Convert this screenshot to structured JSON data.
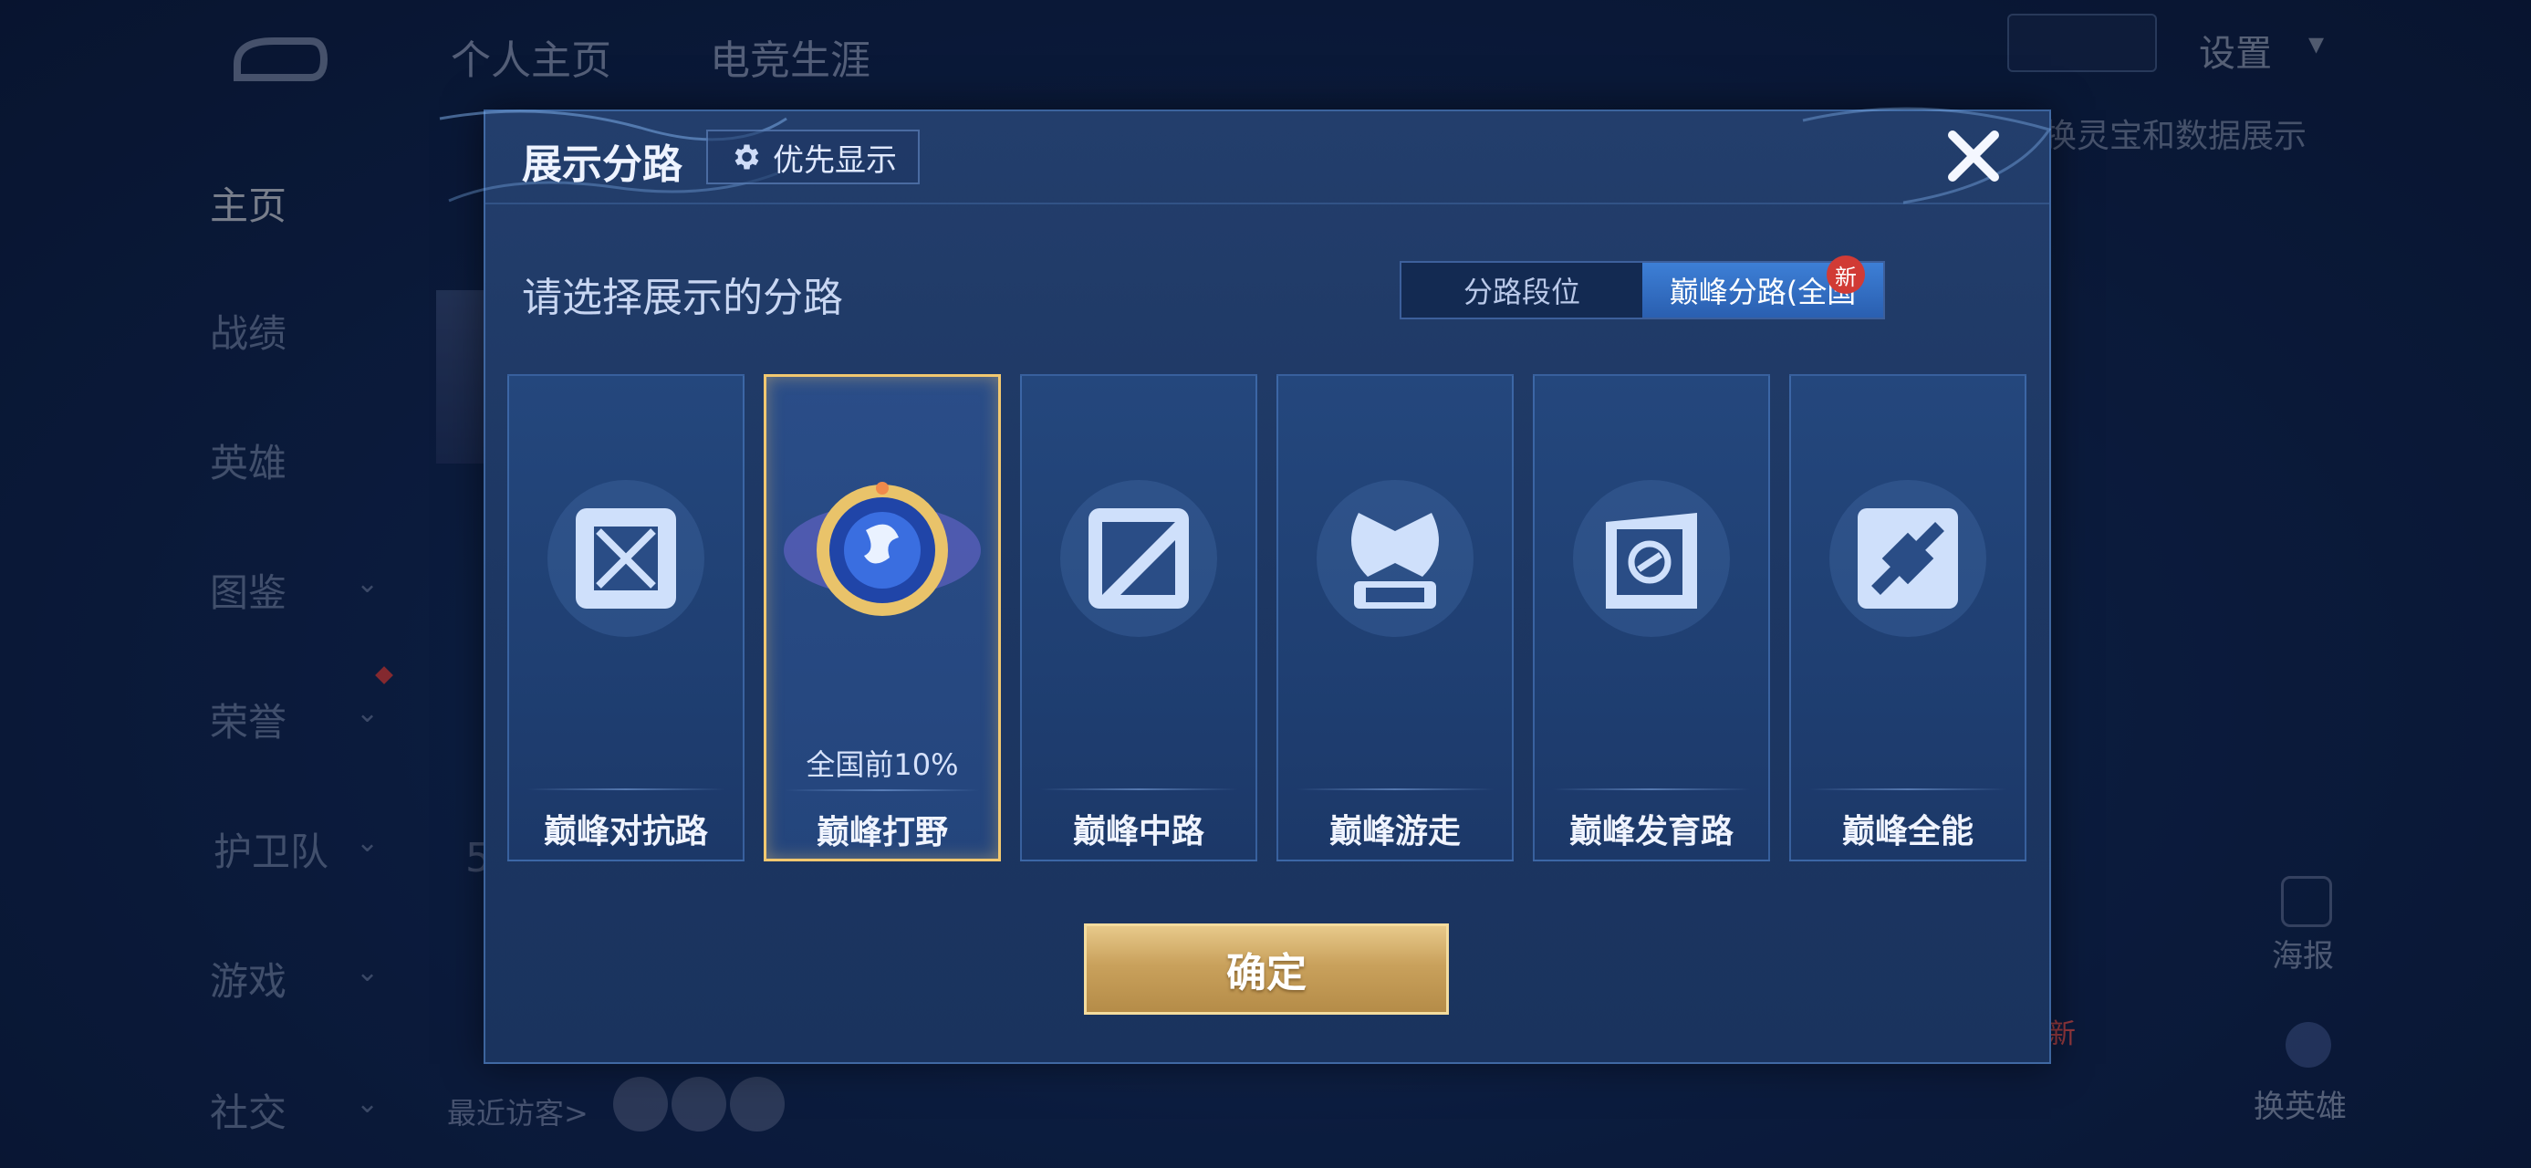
{
  "background": {
    "top_tabs": [
      "个人主页",
      "电竞生涯"
    ],
    "sidebar": [
      {
        "label": "主页",
        "active": true,
        "has_chevron": false
      },
      {
        "label": "战绩",
        "active": false,
        "has_chevron": false
      },
      {
        "label": "英雄",
        "active": false,
        "has_chevron": false
      },
      {
        "label": "图鉴",
        "active": false,
        "has_chevron": true
      },
      {
        "label": "荣誉",
        "active": false,
        "has_chevron": true
      },
      {
        "label": "护卫队",
        "active": false,
        "has_chevron": true
      },
      {
        "label": "游戏",
        "active": false,
        "has_chevron": true
      },
      {
        "label": "社交",
        "active": false,
        "has_chevron": true
      }
    ],
    "settings_label": "设置",
    "switch_text": "换灵宝和数据展示",
    "poster_label": "海报",
    "swap_hero_label": "换英雄",
    "new_tag": "新",
    "recent_visitors_label": "最近访客>",
    "partial_number": "5"
  },
  "modal": {
    "title": "展示分路",
    "priority_button_label": "优先显示",
    "subtitle": "请选择展示的分路",
    "segments": [
      {
        "label": "分路段位",
        "active": false
      },
      {
        "label": "巅峰分路(全国",
        "active": true
      }
    ],
    "new_badge": "新",
    "cards": [
      {
        "label": "巅峰对抗路",
        "rank": "",
        "selected": false,
        "icon": "sword-cross-icon"
      },
      {
        "label": "巅峰打野",
        "rank": "全国前10%",
        "selected": true,
        "icon": "jungle-dragon-emblem-icon"
      },
      {
        "label": "巅峰中路",
        "rank": "",
        "selected": false,
        "icon": "mid-lane-slash-icon"
      },
      {
        "label": "巅峰游走",
        "rank": "",
        "selected": false,
        "icon": "wings-icon"
      },
      {
        "label": "巅峰发育路",
        "rank": "",
        "selected": false,
        "icon": "bottom-lane-icon"
      },
      {
        "label": "巅峰全能",
        "rank": "",
        "selected": false,
        "icon": "all-round-icon"
      }
    ],
    "confirm_label": "确定"
  },
  "colors": {
    "accent_gold": "#f2c870",
    "active_segment": "#3d7fd6",
    "new_badge": "#d13b35"
  }
}
